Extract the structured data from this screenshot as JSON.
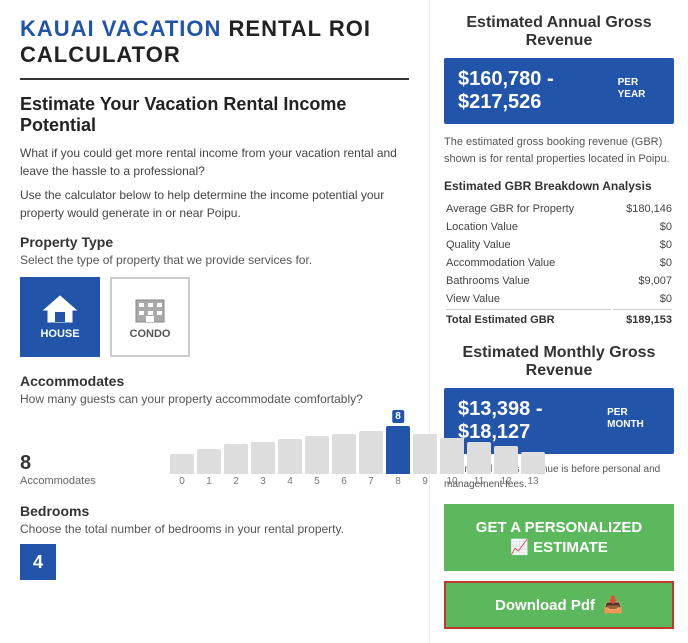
{
  "header": {
    "title_part1": "KAUAI VACATION",
    "title_part2": " RENTAL ROI CALCULATOR"
  },
  "left": {
    "section_title": "Estimate Your Vacation Rental Income Potential",
    "desc1": "What if you could get more rental income from your vacation rental and leave the hassle to a professional?",
    "desc2": "Use the calculator below to help determine the income potential your property would generate in or near Poipu.",
    "property_type_label": "Property Type",
    "property_type_sub": "Select the type of property that we provide services for.",
    "property_options": [
      {
        "id": "house",
        "label": "HOUSE",
        "active": true
      },
      {
        "id": "condo",
        "label": "CONDO",
        "active": false
      }
    ],
    "accommodates_label": "Accommodates",
    "accommodates_sub": "How many guests can your property accommodate comfortably?",
    "slider_value": "8",
    "slider_unit": "Accommodates",
    "bar_axis": [
      "0",
      "1",
      "2",
      "3",
      "4",
      "5",
      "6",
      "7",
      "8",
      "9",
      "10",
      "11",
      "12",
      "13"
    ],
    "bedrooms_label": "Bedrooms",
    "bedrooms_sub": "Choose the total number of bedrooms in your rental property.",
    "bedrooms_value": "4"
  },
  "right": {
    "annual_title": "Estimated Annual Gross Revenue",
    "annual_range": "$160,780 - $217,526",
    "annual_period": "PER YEAR",
    "gbr_note": "The estimated gross booking revenue (GBR) shown is for rental properties located in Poipu.",
    "breakdown_title": "Estimated GBR Breakdown Analysis",
    "breakdown_rows": [
      {
        "label": "Average GBR for Property",
        "value": "$180,146"
      },
      {
        "label": "Location Value",
        "value": "$0"
      },
      {
        "label": "Quality Value",
        "value": "$0"
      },
      {
        "label": "Accommodation Value",
        "value": "$0"
      },
      {
        "label": "Bathrooms Value",
        "value": "$9,007"
      },
      {
        "label": "View Value",
        "value": "$0"
      }
    ],
    "breakdown_total_label": "Total Estimated GBR",
    "breakdown_total_value": "$189,153",
    "monthly_title": "Estimated Monthly Gross Revenue",
    "monthly_range": "$13,398 - $18,127",
    "monthly_period": "PER MONTH",
    "monthly_note": "*Estimated gross revenue is before personal and management fees.",
    "cta_label": "GET A PERSONALIZED",
    "cta_label2": "ESTIMATE",
    "download_label": "Download Pdf"
  }
}
